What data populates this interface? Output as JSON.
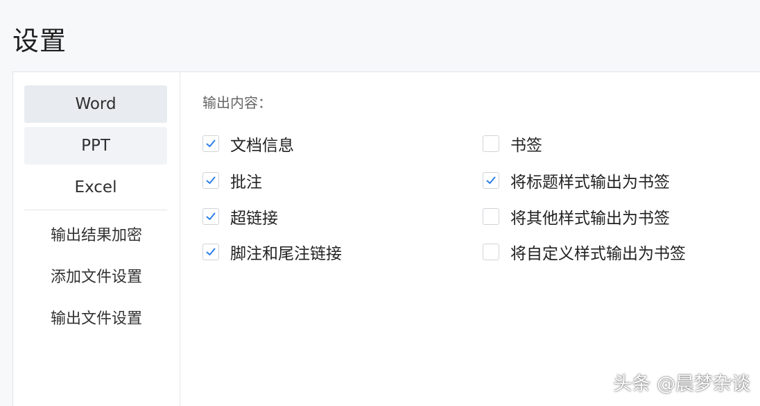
{
  "page": {
    "title": "设置"
  },
  "sidebar": {
    "tabs": [
      {
        "label": "Word",
        "active": true
      },
      {
        "label": "PPT",
        "active": false
      },
      {
        "label": "Excel",
        "active": false
      }
    ],
    "menu": [
      {
        "label": "输出结果加密"
      },
      {
        "label": "添加文件设置"
      },
      {
        "label": "输出文件设置"
      }
    ]
  },
  "content": {
    "section_label": "输出内容：",
    "options_left": [
      {
        "label": "文档信息",
        "checked": true
      },
      {
        "label": "批注",
        "checked": true
      },
      {
        "label": "超链接",
        "checked": true
      },
      {
        "label": "脚注和尾注链接",
        "checked": true
      }
    ],
    "options_right": [
      {
        "label": "书签",
        "checked": false
      },
      {
        "label": "将标题样式输出为书签",
        "checked": true
      },
      {
        "label": "将其他样式输出为书签",
        "checked": false
      },
      {
        "label": "将自定义样式输出为书签",
        "checked": false
      }
    ]
  },
  "watermark": "头条 @晨梦杂谈",
  "colors": {
    "accent": "#2b7de9",
    "active_tab": "#e8ecf1"
  }
}
